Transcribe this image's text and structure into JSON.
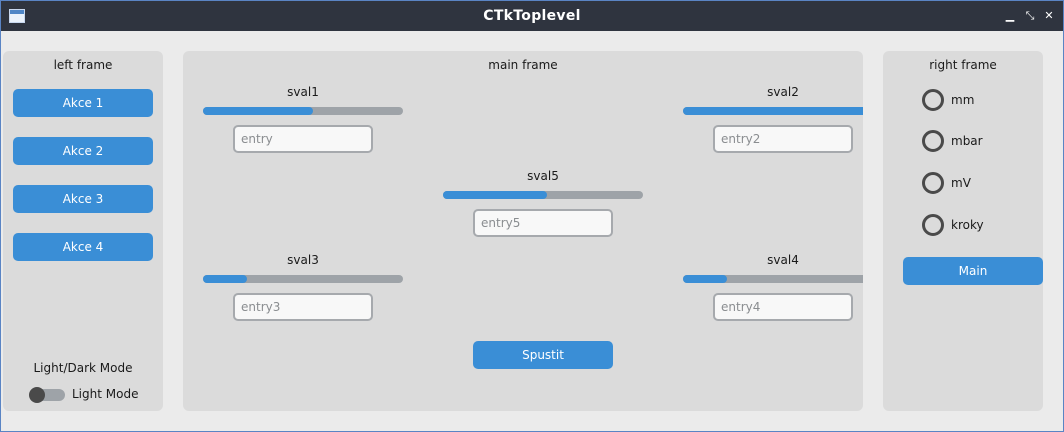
{
  "window": {
    "title": "CTkToplevel"
  },
  "left_frame": {
    "title": "left frame",
    "buttons": [
      "Akce 1",
      "Akce 2",
      "Akce 3",
      "Akce 4"
    ],
    "mode_label": "Light/Dark Mode",
    "switch_label": "Light Mode"
  },
  "main_frame": {
    "title": "main frame",
    "sliders": [
      {
        "label": "sval1",
        "value": 0.55,
        "entry_placeholder": "entry"
      },
      {
        "label": "sval2",
        "value": 1.0,
        "entry_placeholder": "entry2"
      },
      {
        "label": "sval5",
        "value": 0.52,
        "entry_placeholder": "entry5"
      },
      {
        "label": "sval3",
        "value": 0.22,
        "entry_placeholder": "entry3"
      },
      {
        "label": "sval4",
        "value": 0.22,
        "entry_placeholder": "entry4"
      }
    ],
    "run_button": "Spustit"
  },
  "right_frame": {
    "title": "right frame",
    "radios": [
      "mm",
      "mbar",
      "mV",
      "kroky"
    ],
    "main_button": "Main"
  },
  "colors": {
    "accent": "#3a8ed6",
    "frame_bg": "#dbdbdb",
    "window_bg": "#ebebeb",
    "titlebar": "#2f343f"
  }
}
